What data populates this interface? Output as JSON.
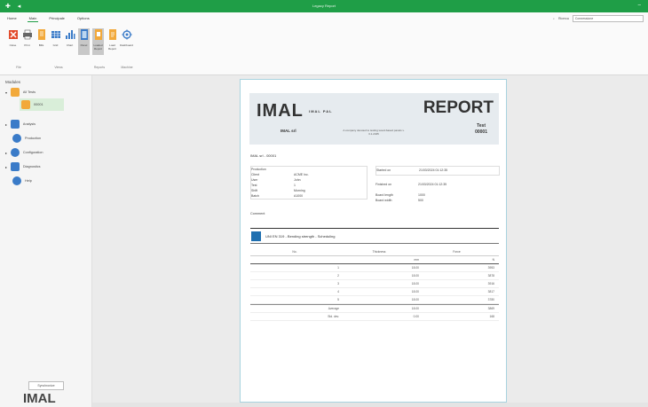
{
  "window": {
    "title": "Legacy Report"
  },
  "menu": [
    "Home",
    "Main",
    "Principale",
    "Options"
  ],
  "search": {
    "label": "Ricerca",
    "value": "Connessione"
  },
  "toolbar": [
    {
      "label": "Close",
      "icon": "close-icon"
    },
    {
      "label": "Print",
      "icon": "print-icon"
    },
    {
      "label": "Bills",
      "icon": "bills-icon"
    },
    {
      "label": "Grid",
      "icon": "grid-icon"
    },
    {
      "label": "Chart",
      "icon": "chart-icon"
    },
    {
      "label": "Panel",
      "icon": "panel-icon"
    },
    {
      "label": "Loaded Report",
      "icon": "report-icon"
    },
    {
      "label": "Load Report",
      "icon": "load-report-icon"
    },
    {
      "label": "Dashboard",
      "icon": "dashboard-icon"
    }
  ],
  "groups": [
    "File",
    "Views",
    "Reports",
    "Machine"
  ],
  "sidebar": {
    "header": "Modules",
    "items": [
      {
        "label": "All Tests",
        "icon": "folder-icon"
      },
      {
        "label": "00001",
        "icon": "report-icon"
      },
      {
        "label": "Analysis",
        "icon": "analysis-icon"
      },
      {
        "label": "Production",
        "icon": "production-icon"
      },
      {
        "label": "Configuration",
        "icon": "gear-icon"
      },
      {
        "label": "Diagnostics",
        "icon": "diagnostics-icon"
      },
      {
        "label": "Help",
        "icon": "help-icon"
      }
    ],
    "sync_button": "Synchronize",
    "logo": "IMAL"
  },
  "report": {
    "logo": "IMAL",
    "logo_small": "IMAL PAL",
    "company": "IMAL srl",
    "company_desc": "A company devoted to testing wood-based panels v. 3.1.2345",
    "title": "REPORT",
    "subtitle": "Test",
    "number": "00001",
    "ref": "IMAL srl - 00001",
    "left_info": [
      {
        "k": "Production",
        "v": ""
      },
      {
        "k": "Client",
        "v": "ACME Inc."
      },
      {
        "k": "User",
        "v": "John"
      },
      {
        "k": "Test",
        "v": "1"
      },
      {
        "k": "Shift",
        "v": "Morning"
      },
      {
        "k": "Batch",
        "v": "A1000"
      }
    ],
    "right_info": [
      {
        "k": "Started on",
        "v": "21/03/2024 01:12:35"
      },
      {
        "k": "Finished on",
        "v": "21/03/2024 01:12:35"
      },
      {
        "k": "Board length",
        "v": "1000"
      },
      {
        "k": "Board width",
        "v": "500"
      }
    ],
    "comment_label": "Comment",
    "test_title": "UNI EN 319 - Bending strength - Scheduling",
    "table": {
      "headers": [
        "No.",
        "Thickness",
        "Force"
      ],
      "units": [
        "",
        "mm",
        "N"
      ],
      "rows": [
        [
          "1",
          "18.00",
          "3953"
        ],
        [
          "2",
          "18.00",
          "3878"
        ],
        [
          "3",
          "18.00",
          "3916"
        ],
        [
          "4",
          "18.00",
          "3817"
        ],
        [
          "5",
          "18.00",
          "3780"
        ]
      ],
      "footer": [
        [
          "Average",
          "18.00",
          "3869"
        ],
        [
          "Std. dev.",
          "0.00",
          "168"
        ]
      ]
    }
  }
}
